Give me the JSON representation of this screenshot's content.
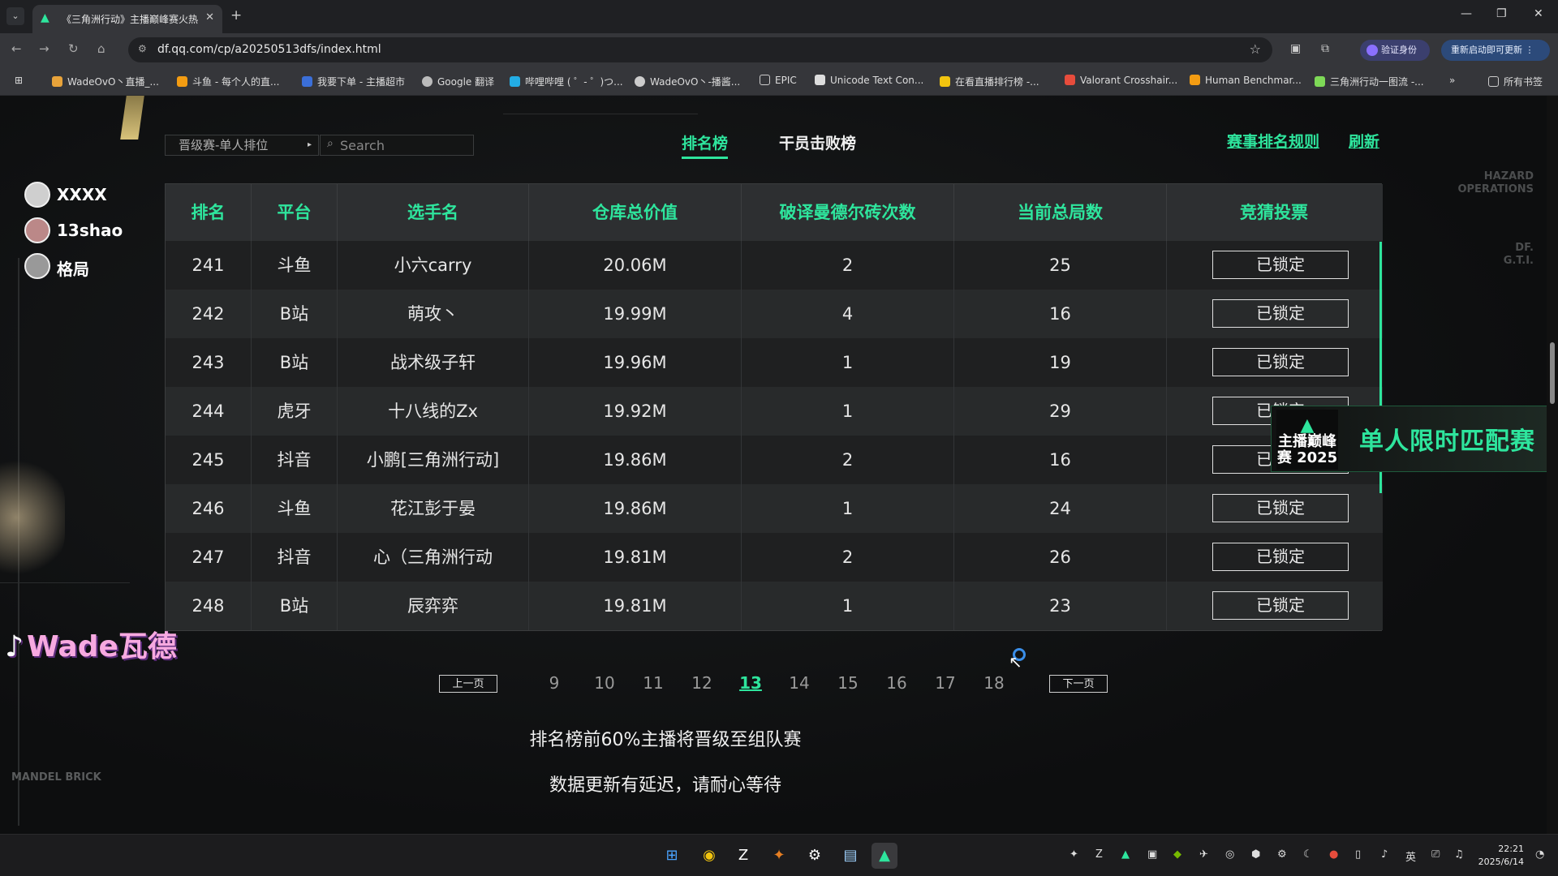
{
  "browser": {
    "tab_title": "《三角洲行动》主播巅峰赛火热",
    "url": "df.qq.com/cp/a20250513dfs/index.html",
    "verify_label": "验证身份",
    "update_label": "重新启动即可更新",
    "bookmarks": [
      "WadeOvO丶直播_...",
      "斗鱼 - 每个人的直...",
      "我要下单 - 主播超市",
      "Google 翻译",
      "哔哩哔哩 ( ゜- ゜)つ...",
      "WadeOvO丶-播酱...",
      "EPIC",
      "Unicode Text Con...",
      "在看直播排行榜 -...",
      "Valorant Crosshair...",
      "Human Benchmar...",
      "三角洲行动一图流 -..."
    ],
    "all_bookmarks": "所有书签"
  },
  "page": {
    "select_value": "晋级赛-单人排位",
    "search_placeholder": "Search",
    "tab_rank": "排名榜",
    "tab_kills": "干员击败榜",
    "rules_link": "赛事排名规则",
    "refresh_link": "刷新",
    "hazard_label": "HAZARD OPERATIONS",
    "dfgti_label": "DF. G.T.I.",
    "mandel_label": "MANDEL BRICK"
  },
  "overlay": {
    "viewers": [
      "XXXX",
      "13shao",
      "格局"
    ],
    "streamer_name": "Wade瓦德",
    "banner_logo": "主播巅峰赛 2025",
    "banner_text": "单人限时匹配赛"
  },
  "table": {
    "headers": [
      "排名",
      "平台",
      "选手名",
      "仓库总价值",
      "破译曼德尔砖次数",
      "当前总局数",
      "竞猜投票"
    ],
    "rows": [
      {
        "rank": "241",
        "platform": "斗鱼",
        "name": "小六carry",
        "value": "20.06M",
        "decode": "2",
        "games": "25",
        "vote": "已锁定"
      },
      {
        "rank": "242",
        "platform": "B站",
        "name": "萌攻丶",
        "value": "19.99M",
        "decode": "4",
        "games": "16",
        "vote": "已锁定"
      },
      {
        "rank": "243",
        "platform": "B站",
        "name": "战术级子轩",
        "value": "19.96M",
        "decode": "1",
        "games": "19",
        "vote": "已锁定"
      },
      {
        "rank": "244",
        "platform": "虎牙",
        "name": "十八线的Zx",
        "value": "19.92M",
        "decode": "1",
        "games": "29",
        "vote": "已锁定"
      },
      {
        "rank": "245",
        "platform": "抖音",
        "name": "小鹏[三角洲行动]",
        "value": "19.86M",
        "decode": "2",
        "games": "16",
        "vote": "已锁定"
      },
      {
        "rank": "246",
        "platform": "斗鱼",
        "name": "花江彭于晏",
        "value": "19.86M",
        "decode": "1",
        "games": "24",
        "vote": "已锁定"
      },
      {
        "rank": "247",
        "platform": "抖音",
        "name": "心（三角洲行动",
        "value": "19.81M",
        "decode": "2",
        "games": "26",
        "vote": "已锁定"
      },
      {
        "rank": "248",
        "platform": "B站",
        "name": "辰弈弈",
        "value": "19.81M",
        "decode": "1",
        "games": "23",
        "vote": "已锁定"
      }
    ]
  },
  "pagination": {
    "prev": "上一页",
    "next": "下一页",
    "pages": [
      "9",
      "10",
      "11",
      "12",
      "13",
      "14",
      "15",
      "16",
      "17",
      "18"
    ],
    "current": "13"
  },
  "notices": {
    "line1": "排名榜前60%主播将晋级至组队赛",
    "line2": "数据更新有延迟，请耐心等待"
  },
  "taskbar": {
    "lang": "英",
    "time": "22:21",
    "date": "2025/6/14"
  },
  "colors": {
    "accent": "#2ee59d",
    "table_header_bg": "#2d2f31"
  }
}
